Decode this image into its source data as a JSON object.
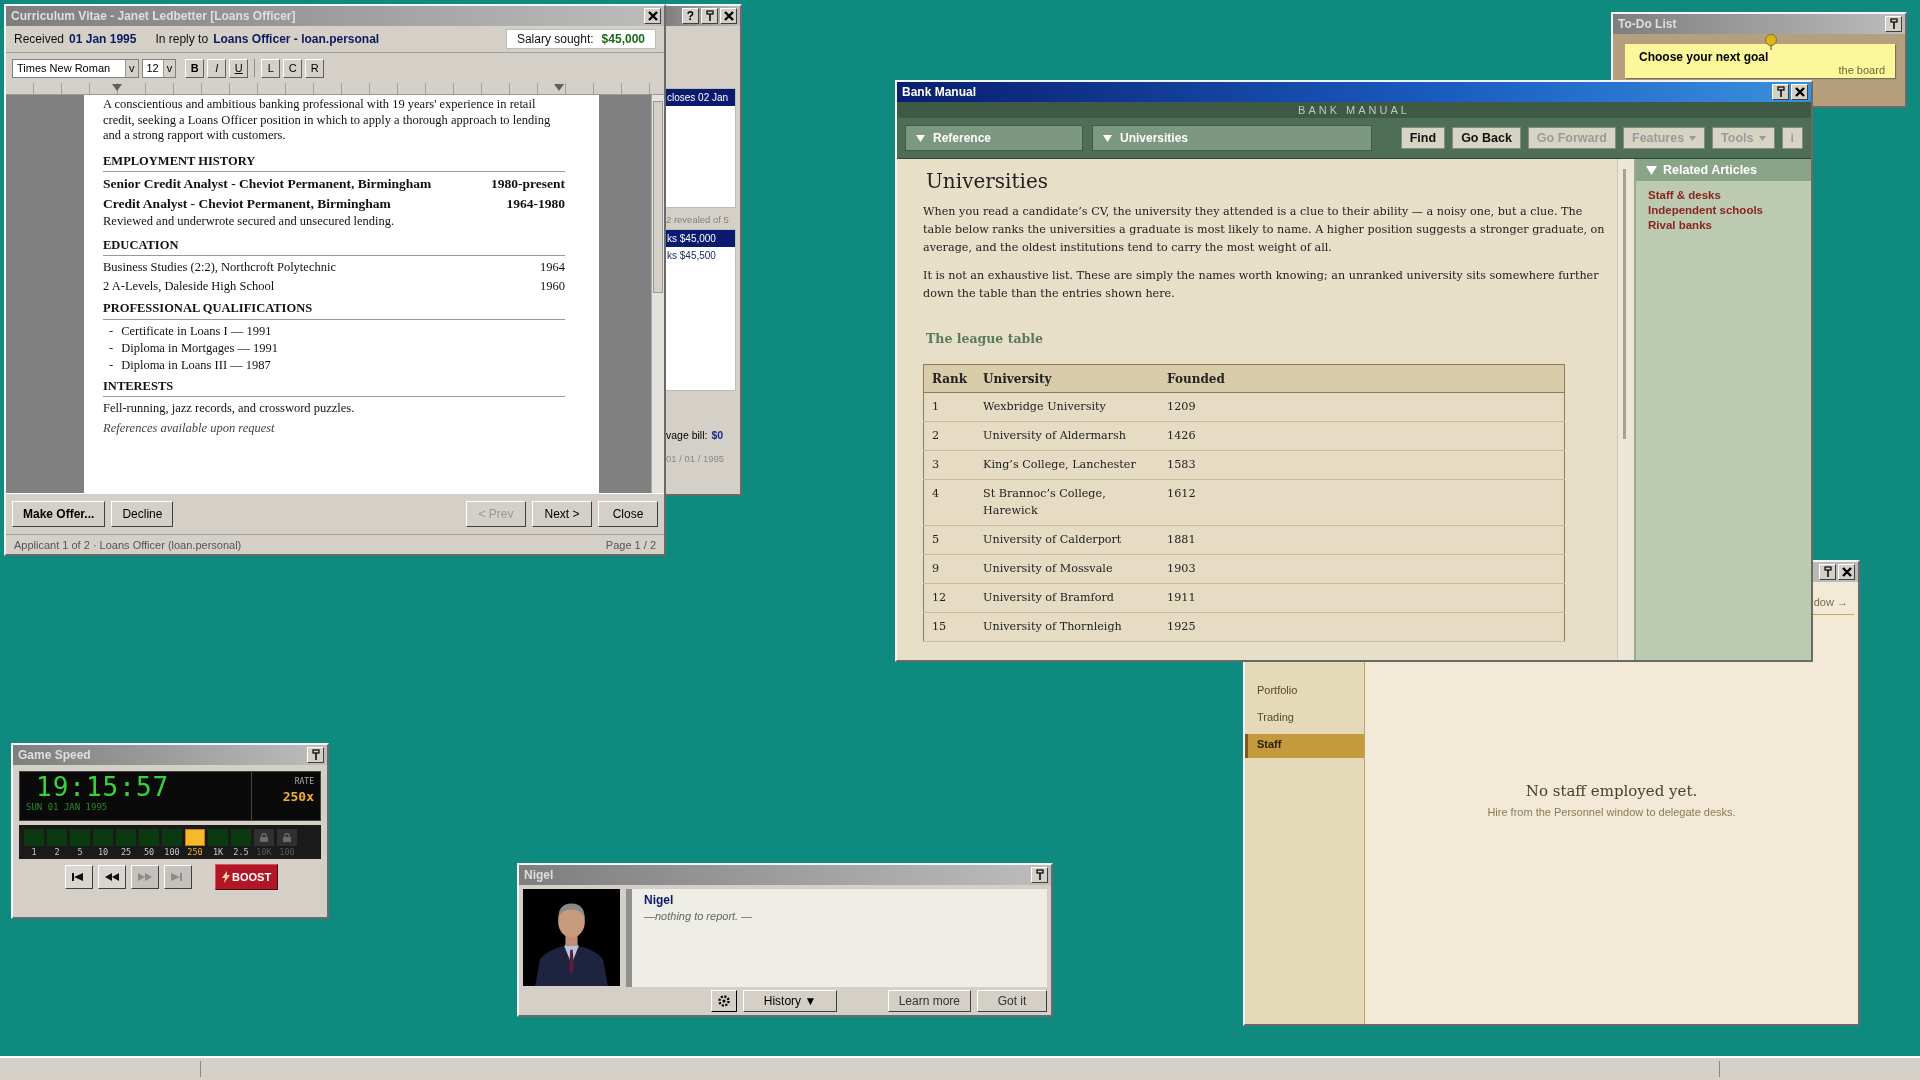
{
  "cv_window": {
    "title": "Curriculum Vitae - Janet Ledbetter [Loans Officer]",
    "received_label": "Received",
    "received_date": "01 Jan 1995",
    "reply_label": "In reply to",
    "reply_position": "Loans Officer - loan.personal",
    "salary_label": "Salary sought:",
    "salary": "$45,000",
    "font_name": "Times New Roman",
    "font_dropdown_mark": "v",
    "font_size": "12",
    "size_dropdown_mark": "v",
    "format_buttons": [
      "B",
      "I",
      "U"
    ],
    "align_buttons": [
      "L",
      "C",
      "R"
    ],
    "document": {
      "intro": "A conscientious and ambitious banking professional with 19 years' experience in retail credit, seeking a Loans Officer position in which to apply a thorough approach to lending and a strong rapport with customers.",
      "sections": [
        {
          "heading": "EMPLOYMENT HISTORY",
          "entries": [
            {
              "kind": "job",
              "text": "Senior Credit Analyst - Cheviot Permanent, Birmingham",
              "date": "1980-present"
            },
            {
              "kind": "job",
              "text": "Credit Analyst - Cheviot Permanent, Birmingham",
              "date": "1964-1980",
              "detail": "Reviewed and underwrote secured and unsecured lending."
            }
          ]
        },
        {
          "heading": "EDUCATION",
          "entries": [
            {
              "kind": "line",
              "text": "Business Studies (2:2), Northcroft Polytechnic",
              "date": "1964"
            },
            {
              "kind": "line",
              "text": "2 A-Levels, Daleside High School",
              "date": "1960"
            }
          ]
        },
        {
          "heading": "PROFESSIONAL QUALIFICATIONS",
          "entries": [
            {
              "kind": "bullet",
              "marker": "-",
              "text": "Certificate in Loans I — 1991"
            },
            {
              "kind": "bullet",
              "marker": "-",
              "text": "Diploma in Mortgages — 1991"
            },
            {
              "kind": "bullet",
              "marker": "-",
              "text": "Diploma in Loans III — 1987"
            }
          ]
        },
        {
          "heading": "INTERESTS",
          "entries": [
            {
              "kind": "text",
              "text": "Fell-running, jazz records, and crossword puzzles."
            }
          ]
        }
      ],
      "footer": "References available upon request"
    },
    "left_buttons": [
      {
        "label": "Make Offer...",
        "default": true,
        "disabled": false
      },
      {
        "label": "Decline",
        "default": false,
        "disabled": false
      }
    ],
    "right_buttons": [
      {
        "label": "< Prev",
        "default": false,
        "disabled": true
      },
      {
        "label": "Next >",
        "default": false,
        "disabled": false
      },
      {
        "label": "Close",
        "default": false,
        "disabled": false
      }
    ],
    "status_left": "Applicant 1 of 2 · Loans Officer (loan.personal)",
    "status_right": "Page 1 / 2"
  },
  "personnel_window": {
    "help_label": "?",
    "vacancy": {
      "text": "closes 02 Jan",
      "selected": true
    },
    "revealed": "2 revealed of 5",
    "offers": [
      {
        "text": "ks $45,000",
        "selected": true
      },
      {
        "text": "ks $45,500",
        "selected": false
      }
    ],
    "wage_label": "vage bill:",
    "wage": "$0",
    "date": "01 / 01 / 1995"
  },
  "todo_window": {
    "title": "To-Do List",
    "note_title": "Choose your next goal",
    "note_text": "the board"
  },
  "bank_manual": {
    "title": "Bank Manual",
    "banner": "BANK MANUAL",
    "nav": [
      {
        "label": "Reference"
      },
      {
        "label": "Universities"
      }
    ],
    "buttons": [
      {
        "label": "Find",
        "disabled": false,
        "menu": false
      },
      {
        "label": "Go Back",
        "disabled": false,
        "menu": false
      },
      {
        "label": "Go Forward",
        "disabled": true,
        "menu": false
      },
      {
        "label": "Features",
        "disabled": true,
        "menu": true
      },
      {
        "label": "Tools",
        "disabled": true,
        "menu": true
      },
      {
        "label": "i",
        "disabled": true,
        "menu": false
      }
    ],
    "article": {
      "heading": "Universities",
      "paragraphs": [
        "When you read a candidate’s CV, the university they attended is a clue to their ability — a noisy one, but a clue. The table below ranks the universities a graduate is most likely to name. A higher position suggests a stronger graduate, on average, and the oldest institutions tend to carry the most weight of all.",
        "It is not an exhaustive list. These are simply the names worth knowing; an unranked university sits somewhere further down the table than the entries shown here."
      ],
      "subheading": "The league table",
      "table": {
        "columns": [
          "Rank",
          "University",
          "Founded"
        ],
        "rows": [
          [
            "1",
            "Wexbridge University",
            "1209"
          ],
          [
            "2",
            "University of Aldermarsh",
            "1426"
          ],
          [
            "3",
            "King’s College, Lanchester",
            "1583"
          ],
          [
            "4",
            "St Brannoc’s College, Harewick",
            "1612"
          ],
          [
            "5",
            "University of Calderport",
            "1881"
          ],
          [
            "9",
            "University of Mossvale",
            "1903"
          ],
          [
            "12",
            "University of Bramford",
            "1911"
          ],
          [
            "15",
            "University of Thornleigh",
            "1925"
          ]
        ]
      }
    },
    "related": {
      "heading": "Related Articles",
      "links": [
        "Staff & desks",
        "Independent schools",
        "Rival banks"
      ]
    }
  },
  "staff_window": {
    "link_fragment": "dow →",
    "sidebar": [
      {
        "label": "Portfolio",
        "selected": false
      },
      {
        "label": "Trading",
        "selected": false
      },
      {
        "label": "Staff",
        "selected": true
      }
    ],
    "empty_title": "No staff employed yet.",
    "empty_hint": "Hire from the Personnel window to delegate desks."
  },
  "game_speed": {
    "title": "Game Speed",
    "clock": "19:15:57",
    "date": "SUN 01 JAN 1995",
    "rate_label": "RATE",
    "rate": "250x",
    "speeds": [
      {
        "label": "1",
        "selected": false,
        "locked": false
      },
      {
        "label": "2",
        "selected": false,
        "locked": false
      },
      {
        "label": "5",
        "selected": false,
        "locked": false
      },
      {
        "label": "10",
        "selected": false,
        "locked": false
      },
      {
        "label": "25",
        "selected": false,
        "locked": false
      },
      {
        "label": "50",
        "selected": false,
        "locked": false
      },
      {
        "label": "100",
        "selected": false,
        "locked": false
      },
      {
        "label": "250",
        "selected": true,
        "locked": false
      },
      {
        "label": "1K",
        "selected": false,
        "locked": false
      },
      {
        "label": "2.5",
        "selected": false,
        "locked": false
      },
      {
        "label": "10K",
        "selected": false,
        "locked": true
      },
      {
        "label": "100",
        "selected": false,
        "locked": true
      }
    ],
    "transport": [
      {
        "kind": "skip-back",
        "disabled": false
      },
      {
        "kind": "rewind",
        "disabled": false
      },
      {
        "kind": "fast-forward",
        "disabled": true
      },
      {
        "kind": "skip-end",
        "disabled": true
      }
    ],
    "boost": "BOOST"
  },
  "advisor_window": {
    "title": "Nigel",
    "speaker": "Nigel",
    "message": "—nothing to report. —",
    "history": "History ▼",
    "learn_more": "Learn more",
    "got_it": "Got it"
  }
}
